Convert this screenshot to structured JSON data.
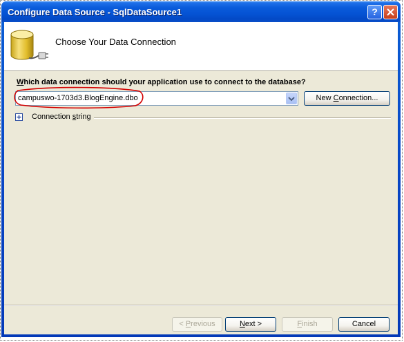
{
  "window": {
    "title": "Configure Data Source - SqlDataSource1",
    "help_glyph": "?",
    "close_glyph": "X"
  },
  "header": {
    "title": "Choose Your Data Connection",
    "icon": "database-plug-icon"
  },
  "question": {
    "underlined": "W",
    "rest": "hich data connection should your application use to connect to the database?"
  },
  "connection_combo": {
    "value": "campuswo-1703d3.BlogEngine.dbo"
  },
  "new_connection_button": {
    "pre": "New ",
    "underlined": "C",
    "post": "onnection..."
  },
  "connection_string": {
    "pre": "Connection ",
    "underlined": "s",
    "post": "tring",
    "expander": "+"
  },
  "footer": {
    "previous": {
      "pre": "< ",
      "underlined": "P",
      "post": "revious"
    },
    "next": {
      "underlined": "N",
      "post": "ext >"
    },
    "finish": {
      "underlined": "F",
      "post": "inish"
    },
    "cancel": {
      "label": "Cancel"
    }
  },
  "colors": {
    "title_bar": "#0553d4",
    "dialog_bg": "#ece9d8",
    "highlight_ellipse": "#d40000"
  }
}
